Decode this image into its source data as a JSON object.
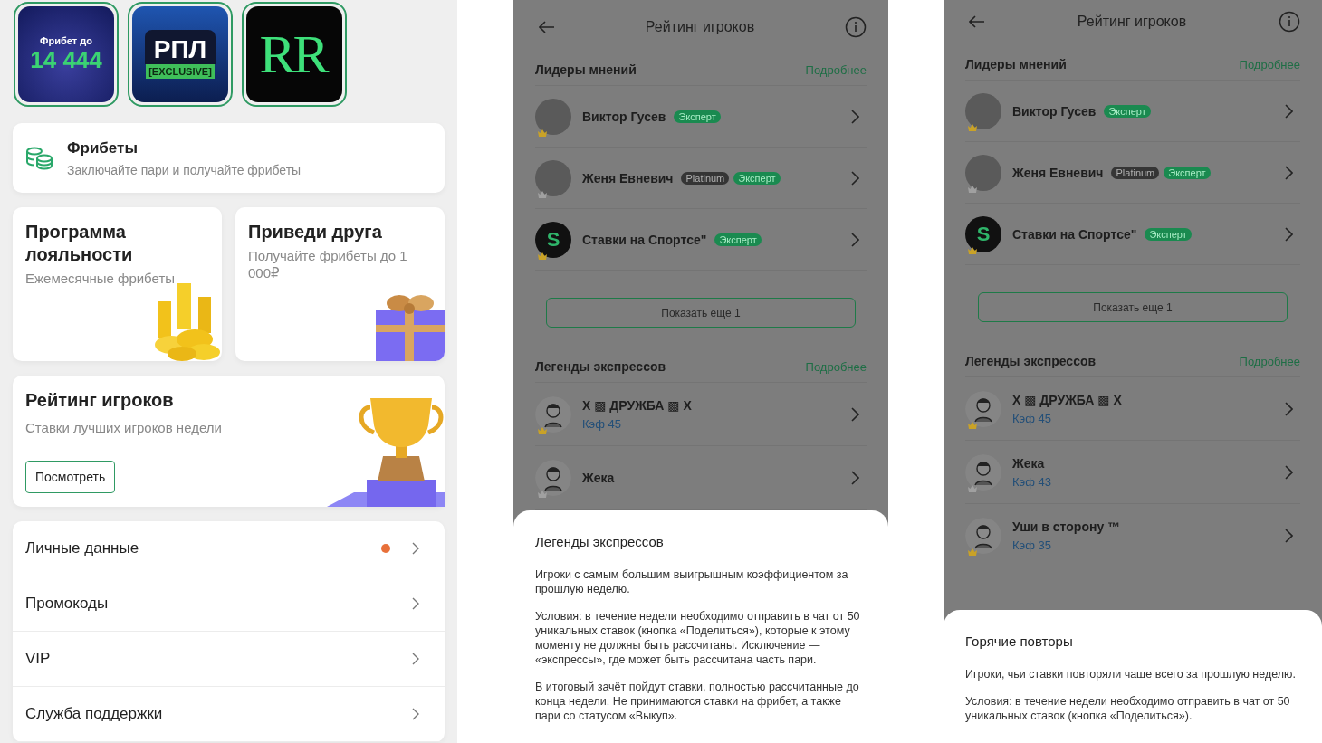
{
  "profile_screen": {
    "stories": [
      {
        "kind": "freebet",
        "line_1": "Фрибет до",
        "line_2": "14 444"
      },
      {
        "kind": "league",
        "line_1": "РПЛ",
        "line_2": "[EXCLUSIVE]"
      },
      {
        "kind": "logo",
        "line_1": "RR"
      }
    ],
    "freebets": {
      "title": "Фрибеты",
      "subtitle": "Заключайте пари и получайте фрибеты"
    },
    "promo_cards": [
      {
        "kind": "coins",
        "title": "Программа лояльности",
        "subtitle": "Ежемесячные фрибеты"
      },
      {
        "kind": "gift",
        "title": "Приведи друга",
        "subtitle": "Получайте фрибеты до 1 000₽"
      }
    ],
    "rating_card": {
      "title": "Рейтинг игроков",
      "subtitle": "Ставки лучших игроков недели",
      "button": "Посмотреть"
    },
    "menu": [
      {
        "label": "Личные данные",
        "notification": true
      },
      {
        "label": "Промокоды",
        "notification": false
      },
      {
        "label": "VIP",
        "notification": false
      },
      {
        "label": "Служба поддержки",
        "notification": false
      }
    ]
  },
  "rating_screens": [
    {
      "title": "Рейтинг игроков",
      "sections": [
        {
          "kind": "leaders",
          "title": "Лидеры мнений",
          "link": "Подробнее",
          "show_more": "Показать еще 1",
          "items": [
            {
              "name": "Виктор Гусев",
              "kind": "photo",
              "color": "#c9a227",
              "badges": [
                {
                  "kind": "expert",
                  "label": "Эксперт"
                }
              ]
            },
            {
              "name": "Женя Евневич",
              "kind": "photo",
              "color": "#a0a0a0",
              "badges": [
                {
                  "kind": "platinum",
                  "label": "Platinum"
                },
                {
                  "kind": "expert",
                  "label": "Эксперт"
                }
              ]
            },
            {
              "name": "Ставки на Спортсе\"",
              "kind": "logo",
              "logo_text": "S",
              "color": "#c9a227",
              "badges": [
                {
                  "kind": "expert",
                  "label": "Эксперт"
                }
              ]
            }
          ]
        },
        {
          "kind": "legends",
          "title": "Легенды экспрессов",
          "link": "Подробнее",
          "items": [
            {
              "name": "X ▩ ДРУЖБА ▩ X",
              "kind": "drawing",
              "color": "#c9a227",
              "koef": "Кэф 45"
            },
            {
              "name": "Жека",
              "kind": "drawing",
              "color": "#a0a0a0"
            }
          ]
        }
      ],
      "sheet": {
        "title": "Легенды экспрессов",
        "paragraphs": [
          "Игроки с самым большим выигрышным коэффициентом за прошлую неделю.",
          "Условия: в течение недели необходимо отправить в чат от 50 уникальных ставок (кнопка «Поделиться»), которые к этому моменту не должны быть рассчитаны. Исключение — «экспрессы», где может быть рассчитана часть пари.",
          "В итоговый зачёт пойдут ставки, полностью рассчитанные до конца недели. Не принимаются ставки на фрибет, а также пари со статусом «Выкуп»."
        ]
      }
    },
    {
      "title": "Рейтинг игроков",
      "sections": [
        {
          "kind": "leaders",
          "title": "Лидеры мнений",
          "link": "Подробнее",
          "show_more": "Показать еще 1",
          "items": [
            {
              "name": "Виктор Гусев",
              "kind": "photo",
              "color": "#c9a227",
              "badges": [
                {
                  "kind": "expert",
                  "label": "Эксперт"
                }
              ]
            },
            {
              "name": "Женя Евневич",
              "kind": "photo",
              "color": "#a0a0a0",
              "badges": [
                {
                  "kind": "platinum",
                  "label": "Platinum"
                },
                {
                  "kind": "expert",
                  "label": "Эксперт"
                }
              ]
            },
            {
              "name": "Ставки на Спортсе\"",
              "kind": "logo",
              "logo_text": "S",
              "color": "#c9a227",
              "badges": [
                {
                  "kind": "expert",
                  "label": "Эксперт"
                }
              ]
            }
          ]
        },
        {
          "kind": "legends",
          "title": "Легенды экспрессов",
          "link": "Подробнее",
          "items": [
            {
              "name": "X ▩ ДРУЖБА ▩ X",
              "kind": "drawing",
              "color": "#c9a227",
              "koef": "Кэф 45"
            },
            {
              "name": "Жека",
              "kind": "drawing",
              "color": "#a0a0a0",
              "koef": "Кэф 43"
            },
            {
              "name": "Уши в сторону ™",
              "kind": "drawing",
              "color": "#c9a227",
              "koef": "Кэф 35"
            }
          ]
        }
      ],
      "sheet": {
        "title": "Горячие повторы",
        "paragraphs": [
          "Игроки, чьи ставки повторяли чаще всего за прошлую неделю.",
          "Условия: в течение недели необходимо отправить в чат от 50 уникальных ставок (кнопка «Поделиться»)."
        ]
      }
    }
  ]
}
